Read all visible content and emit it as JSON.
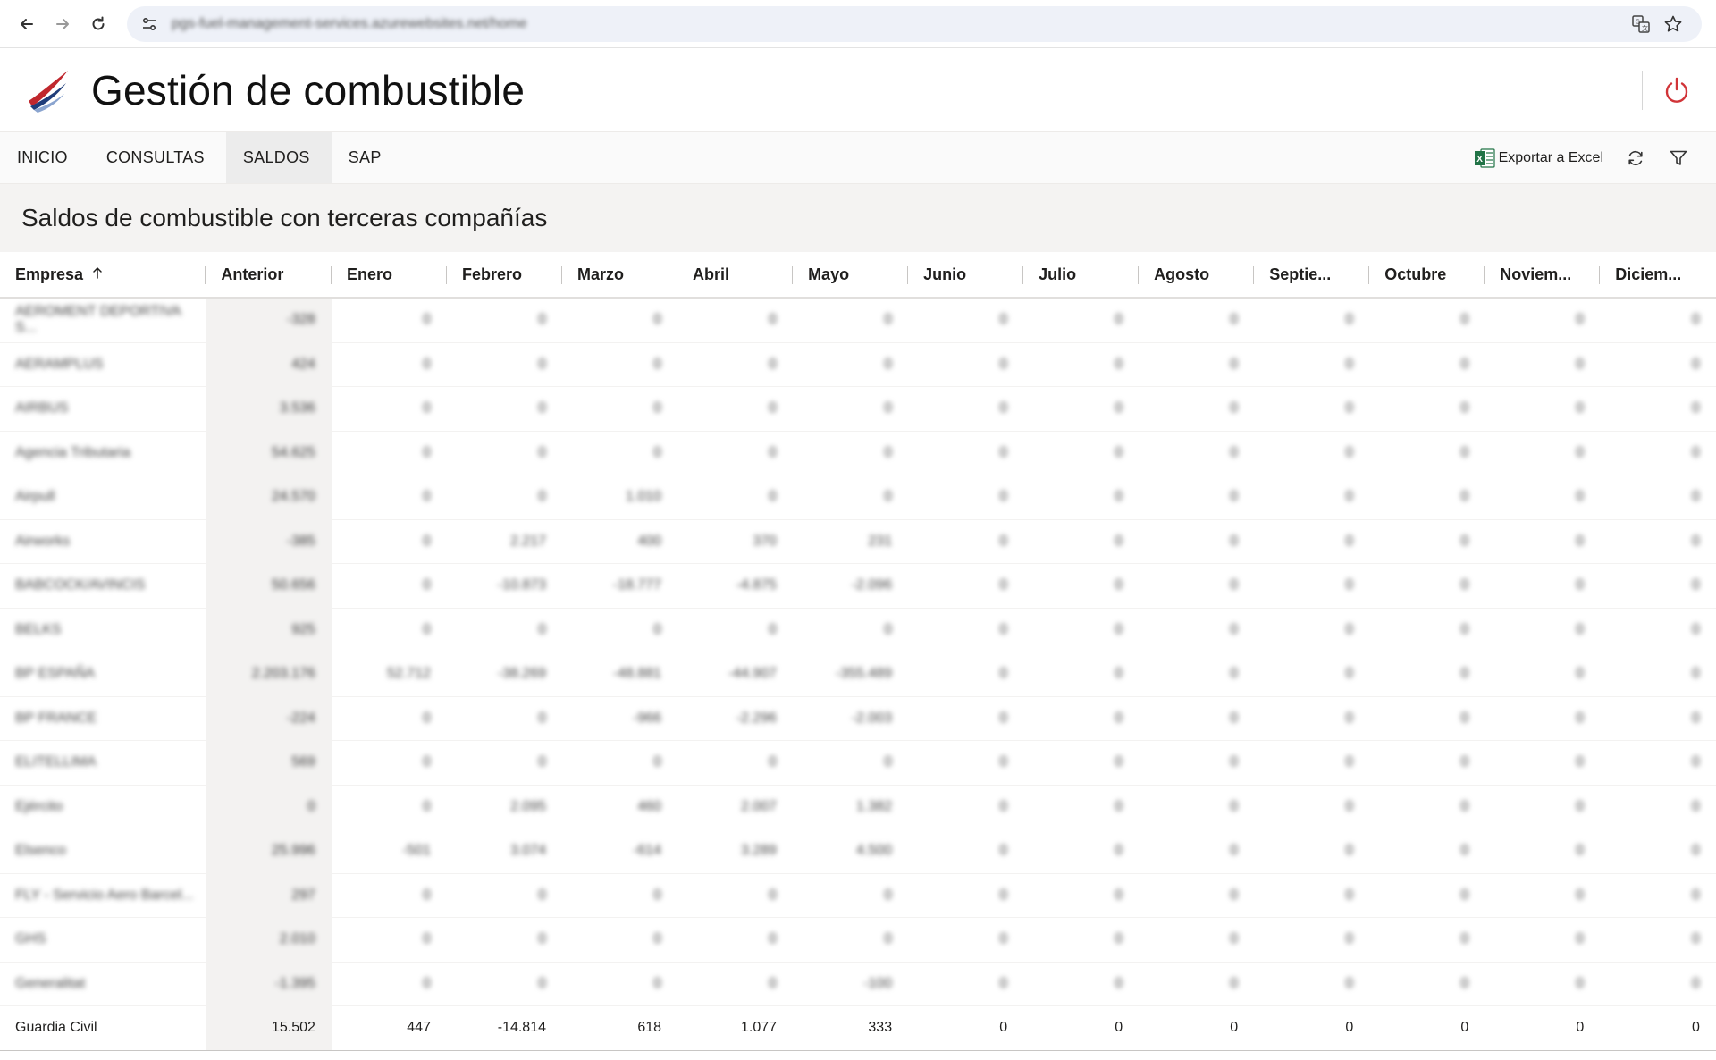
{
  "browser": {
    "url": "pgs-fuel-management-services.azurewebsites.net/home"
  },
  "app": {
    "title": "Gestión de combustible"
  },
  "nav": {
    "items": [
      {
        "label": "INICIO",
        "active": false
      },
      {
        "label": "CONSULTAS",
        "active": false
      },
      {
        "label": "SALDOS",
        "active": true
      },
      {
        "label": "SAP",
        "active": false
      }
    ],
    "export_label": "Exportar a Excel"
  },
  "page": {
    "title": "Saldos de combustible con terceras compañías"
  },
  "table": {
    "columns": [
      "Empresa",
      "Anterior",
      "Enero",
      "Febrero",
      "Marzo",
      "Abril",
      "Mayo",
      "Junio",
      "Julio",
      "Agosto",
      "Septie...",
      "Octubre",
      "Noviem...",
      "Diciem..."
    ],
    "sort": {
      "column": "Empresa",
      "direction": "asc"
    },
    "rows": [
      {
        "blurred": true,
        "cells": [
          "AEROMENT DEPORTIVA S...",
          "-328",
          "0",
          "0",
          "0",
          "0",
          "0",
          "0",
          "0",
          "0",
          "0",
          "0",
          "0",
          "0"
        ]
      },
      {
        "blurred": true,
        "cells": [
          "AERAMPLUS",
          "424",
          "0",
          "0",
          "0",
          "0",
          "0",
          "0",
          "0",
          "0",
          "0",
          "0",
          "0",
          "0"
        ]
      },
      {
        "blurred": true,
        "cells": [
          "AIRBUS",
          "3.536",
          "0",
          "0",
          "0",
          "0",
          "0",
          "0",
          "0",
          "0",
          "0",
          "0",
          "0",
          "0"
        ]
      },
      {
        "blurred": true,
        "cells": [
          "Agencia Tributaria",
          "54.625",
          "0",
          "0",
          "0",
          "0",
          "0",
          "0",
          "0",
          "0",
          "0",
          "0",
          "0",
          "0"
        ]
      },
      {
        "blurred": true,
        "cells": [
          "Airpull",
          "24.570",
          "0",
          "0",
          "1.010",
          "0",
          "0",
          "0",
          "0",
          "0",
          "0",
          "0",
          "0",
          "0"
        ]
      },
      {
        "blurred": true,
        "cells": [
          "Airworks",
          "-385",
          "0",
          "2.217",
          "400",
          "370",
          "231",
          "0",
          "0",
          "0",
          "0",
          "0",
          "0",
          "0"
        ]
      },
      {
        "blurred": true,
        "cells": [
          "BABCOCK/AVINCIS",
          "50.656",
          "0",
          "-10.873",
          "-18.777",
          "-4.875",
          "-2.096",
          "0",
          "0",
          "0",
          "0",
          "0",
          "0",
          "0"
        ]
      },
      {
        "blurred": true,
        "cells": [
          "BELKS",
          "925",
          "0",
          "0",
          "0",
          "0",
          "0",
          "0",
          "0",
          "0",
          "0",
          "0",
          "0",
          "0"
        ]
      },
      {
        "blurred": true,
        "cells": [
          "BP ESPAÑA",
          "2.203.176",
          "52.712",
          "-38.269",
          "-48.881",
          "-44.907",
          "-355.489",
          "0",
          "0",
          "0",
          "0",
          "0",
          "0",
          "0"
        ]
      },
      {
        "blurred": true,
        "cells": [
          "BP FRANCE",
          "-224",
          "0",
          "0",
          "-966",
          "-2.296",
          "-2.003",
          "0",
          "0",
          "0",
          "0",
          "0",
          "0",
          "0"
        ]
      },
      {
        "blurred": true,
        "cells": [
          "ELITELLIMA",
          "569",
          "0",
          "0",
          "0",
          "0",
          "0",
          "0",
          "0",
          "0",
          "0",
          "0",
          "0",
          "0"
        ]
      },
      {
        "blurred": true,
        "cells": [
          "Ejército",
          "0",
          "0",
          "2.095",
          "460",
          "2.007",
          "1.382",
          "0",
          "0",
          "0",
          "0",
          "0",
          "0",
          "0"
        ]
      },
      {
        "blurred": true,
        "cells": [
          "Elsenco",
          "25.996",
          "-501",
          "3.074",
          "-614",
          "3.289",
          "4.500",
          "0",
          "0",
          "0",
          "0",
          "0",
          "0",
          "0"
        ]
      },
      {
        "blurred": true,
        "cells": [
          "FLY - Servicio Aero Barcel...",
          "297",
          "0",
          "0",
          "0",
          "0",
          "0",
          "0",
          "0",
          "0",
          "0",
          "0",
          "0",
          "0"
        ]
      },
      {
        "blurred": true,
        "cells": [
          "GHS",
          "2.010",
          "0",
          "0",
          "0",
          "0",
          "0",
          "0",
          "0",
          "0",
          "0",
          "0",
          "0",
          "0"
        ]
      },
      {
        "blurred": true,
        "cells": [
          "Generalitat",
          "-1.395",
          "0",
          "0",
          "0",
          "0",
          "-100",
          "0",
          "0",
          "0",
          "0",
          "0",
          "0",
          "0"
        ]
      },
      {
        "blurred": false,
        "cells": [
          "Guardia Civil",
          "15.502",
          "447",
          "-14.814",
          "618",
          "1.077",
          "333",
          "0",
          "0",
          "0",
          "0",
          "0",
          "0",
          "0"
        ]
      }
    ]
  },
  "colors": {
    "accent_red": "#d13438",
    "excel_green": "#217346",
    "logo_blue": "#1f3d7a"
  }
}
